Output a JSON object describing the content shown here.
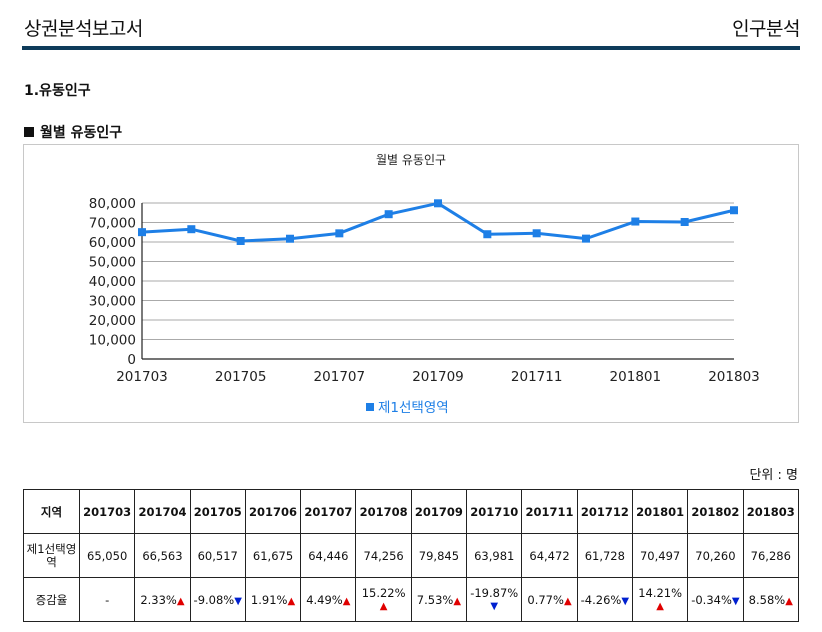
{
  "header": {
    "title": "상권분석보고서",
    "right": "인구분석"
  },
  "section_title": "1.유동인구",
  "subsection_title": "월별 유동인구",
  "unit_label": "단위 : 명",
  "colors": {
    "accent": "#0e3b5a",
    "series": "#1e7fe6",
    "up": "#e00000",
    "down": "#0020d0"
  },
  "chart_data": {
    "type": "line",
    "title": "월별 유동인구",
    "x": [
      "201703",
      "201704",
      "201705",
      "201706",
      "201707",
      "201708",
      "201709",
      "201710",
      "201711",
      "201712",
      "201801",
      "201802",
      "201803"
    ],
    "x_tick_labels": [
      "201703",
      "201705",
      "201707",
      "201709",
      "201711",
      "201801",
      "201803"
    ],
    "series": [
      {
        "name": "제1선택영역",
        "values": [
          65050,
          66563,
          60517,
          61675,
          64446,
          74256,
          79845,
          63981,
          64472,
          61728,
          70497,
          70260,
          76286
        ]
      }
    ],
    "ylim": [
      0,
      80000
    ],
    "y_ticks": [
      "0",
      "10,000",
      "20,000",
      "30,000",
      "40,000",
      "50,000",
      "60,000",
      "70,000",
      "80,000"
    ],
    "grid": true,
    "legend": "bottom"
  },
  "table": {
    "headers": [
      "지역",
      "201703",
      "201704",
      "201705",
      "201706",
      "201707",
      "201708",
      "201709",
      "201710",
      "201711",
      "201712",
      "201801",
      "201802",
      "201803"
    ],
    "row1": {
      "label": "제1선택영역",
      "values": [
        "65,050",
        "66,563",
        "60,517",
        "61,675",
        "64,446",
        "74,256",
        "79,845",
        "63,981",
        "64,472",
        "61,728",
        "70,497",
        "70,260",
        "76,286"
      ]
    },
    "row2": {
      "label": "증감율",
      "first": "-",
      "rates": [
        {
          "text": "2.33%",
          "dir": "up",
          "stacked": false
        },
        {
          "text": "-9.08%",
          "dir": "down",
          "stacked": false
        },
        {
          "text": "1.91%",
          "dir": "up",
          "stacked": false
        },
        {
          "text": "4.49%",
          "dir": "up",
          "stacked": false
        },
        {
          "text": "15.22%",
          "dir": "up",
          "stacked": true
        },
        {
          "text": "7.53%",
          "dir": "up",
          "stacked": false
        },
        {
          "text": "-19.87%",
          "dir": "down",
          "stacked": true
        },
        {
          "text": "0.77%",
          "dir": "up",
          "stacked": false
        },
        {
          "text": "-4.26%",
          "dir": "down",
          "stacked": false
        },
        {
          "text": "14.21%",
          "dir": "up",
          "stacked": true
        },
        {
          "text": "-0.34%",
          "dir": "down",
          "stacked": false
        },
        {
          "text": "8.58%",
          "dir": "up",
          "stacked": false
        }
      ]
    }
  }
}
